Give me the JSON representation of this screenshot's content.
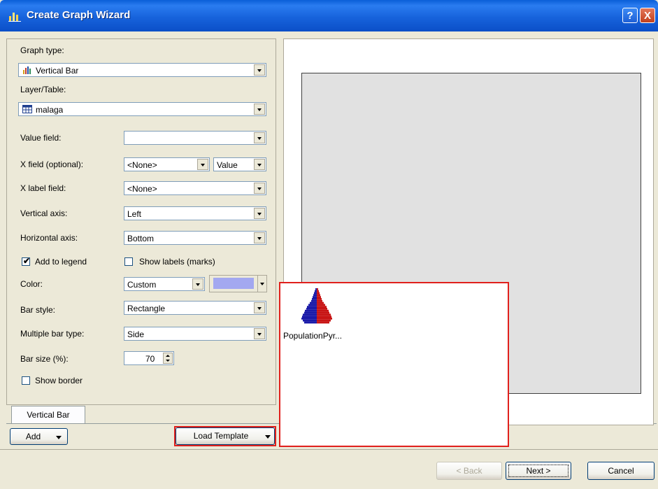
{
  "window": {
    "title": "Create Graph Wizard",
    "help_glyph": "?",
    "close_glyph": "X"
  },
  "form": {
    "graph_type": {
      "label": "Graph type:",
      "value": "Vertical Bar",
      "icon": "bar-chart-icon"
    },
    "layer_table": {
      "label": "Layer/Table:",
      "value": "malaga",
      "icon": "table-icon"
    },
    "value_field": {
      "label": "Value field:",
      "value": ""
    },
    "x_field": {
      "label": "X field (optional):",
      "value": "<None>",
      "secondary_value": "Value"
    },
    "x_label_field": {
      "label": "X label field:",
      "value": "<None>"
    },
    "vertical_axis": {
      "label": "Vertical axis:",
      "value": "Left"
    },
    "horizontal_axis": {
      "label": "Horizontal axis:",
      "value": "Bottom"
    },
    "add_to_legend": {
      "label": "Add to legend",
      "checked": true,
      "check_glyph": "✔"
    },
    "show_labels": {
      "label": "Show labels (marks)",
      "checked": false
    },
    "color": {
      "label": "Color:",
      "value": "Custom",
      "swatch": "#a3a8f0"
    },
    "bar_style": {
      "label": "Bar style:",
      "value": "Rectangle"
    },
    "multiple_bar_type": {
      "label": "Multiple bar type:",
      "value": "Side"
    },
    "bar_size": {
      "label": "Bar size (%):",
      "value": "70"
    },
    "show_border": {
      "label": "Show border",
      "checked": false
    }
  },
  "tabs": [
    {
      "label": "Vertical Bar"
    }
  ],
  "buttons": {
    "add": "Add",
    "load_template": "Load Template",
    "back": "< Back",
    "next": "Next >",
    "cancel": "Cancel"
  },
  "template_popup": {
    "items": [
      {
        "label": "PopulationPyr...",
        "icon": "population-pyramid-icon",
        "colors": [
          "#1a1aa8",
          "#c81414"
        ]
      }
    ]
  },
  "colors": {
    "highlight_border": "#e0201c",
    "titlebar": "#1763dc"
  }
}
